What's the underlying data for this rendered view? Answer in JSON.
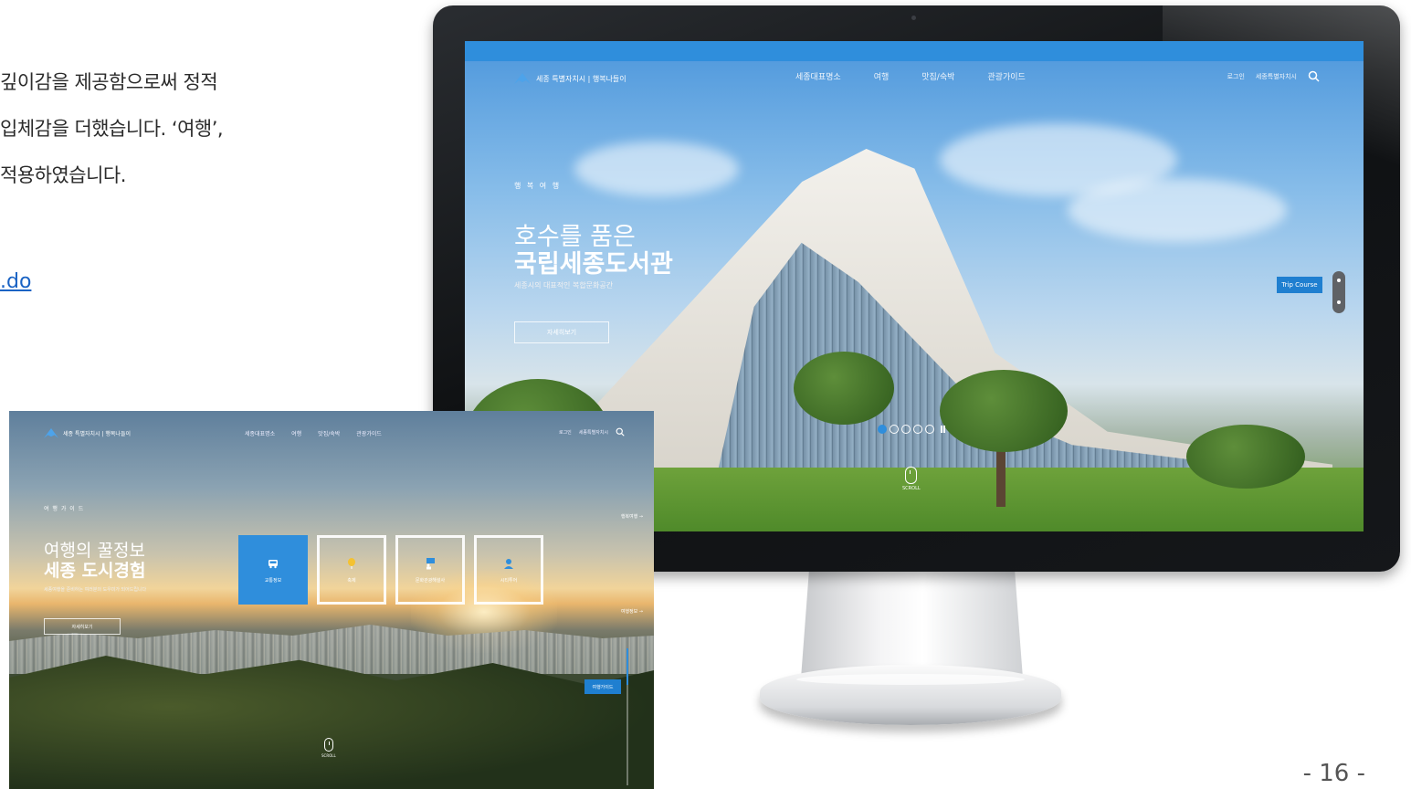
{
  "document": {
    "lines": [
      "깊이감을 제공함으로써 정적",
      "입체감을 더했습니다. ‘여행’,",
      "적용하였습니다."
    ],
    "link_text": ".do",
    "page_number": "- 16 -"
  },
  "colors": {
    "brand_blue": "#2f8edc",
    "button_blue": "#1f7fd0"
  },
  "monitor_site": {
    "logo_text": "세종 특별자치시 | 행복나들이",
    "nav": [
      "세종대표명소",
      "여행",
      "맛집/숙박",
      "관광가이드"
    ],
    "util": [
      "로그인",
      "세종특별자치시"
    ],
    "search_icon": "search-icon",
    "hero": {
      "kicker": "행 복 여 행",
      "title_line1": "호수를 품은",
      "title_line2": "국립세종도서관",
      "description": "세종시의 대표적인 복합문화공간",
      "button_label": "자세히보기"
    },
    "trip_course_label": "Trip Course",
    "slider": {
      "count": 5,
      "active": 1
    },
    "scroll_label": "SCROLL"
  },
  "laptop_site": {
    "logo_text": "세종 특별자치시 | 행복나들이",
    "nav": [
      "세종대표명소",
      "여행",
      "맛집/숙박",
      "관광가이드"
    ],
    "util": [
      "로그인",
      "세종특별자치시"
    ],
    "hero": {
      "kicker": "여 행 가 이 드",
      "title_line1": "여행의 꿀정보",
      "title_line2": "세종 도시경험",
      "description": "세종여행을 준비하는 여러분의 도우미가 되어드립니다",
      "button_label": "자세히보기"
    },
    "tiles": [
      {
        "label": "교통정보",
        "icon": "bus-icon",
        "active": true
      },
      {
        "label": "축제",
        "icon": "balloon-icon",
        "active": false
      },
      {
        "label": "문화관광해설사",
        "icon": "guide-icon",
        "active": false
      },
      {
        "label": "시티투어",
        "icon": "tour-person-icon",
        "active": false
      }
    ],
    "side_links": [
      "행복여행 →",
      "여행정보 →"
    ],
    "guide_button_label": "여행가이드",
    "scroll_label": "SCROLL"
  }
}
